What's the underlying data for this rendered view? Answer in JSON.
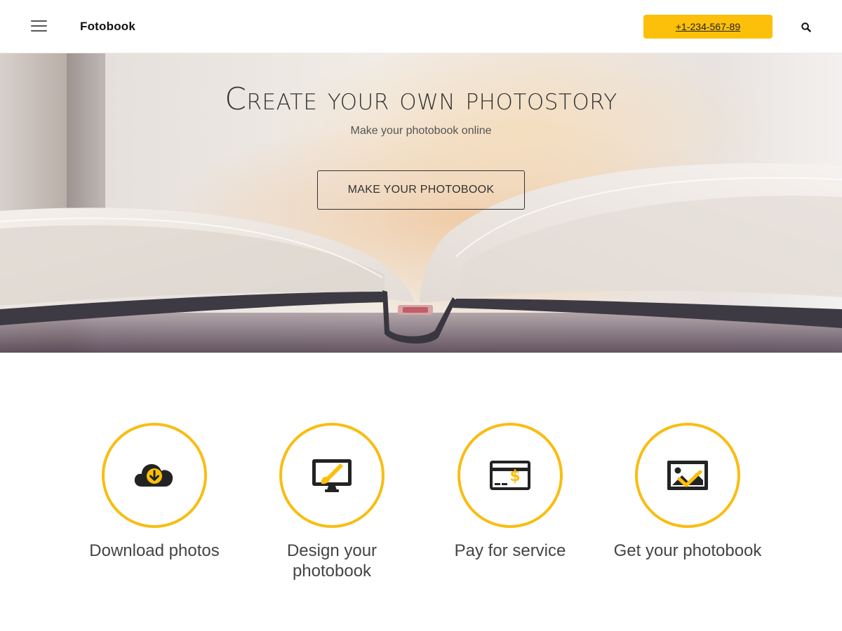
{
  "header": {
    "brand": "Fotobook",
    "phone": "+1-234-567-89",
    "menu_icon": "hamburger-menu-icon",
    "search_icon": "search-icon",
    "accent_color": "#fcbf0a"
  },
  "hero": {
    "title": "Create your own photostory",
    "subtitle": "Make your photobook online",
    "cta_label": "MAKE YOUR PHOTOBOOK"
  },
  "steps": [
    {
      "icon": "cloud-download-icon",
      "label": "Download photos"
    },
    {
      "icon": "monitor-brush-icon",
      "label": "Design your photobook"
    },
    {
      "icon": "card-dollar-icon",
      "label": "Pay for service"
    },
    {
      "icon": "image-check-icon",
      "label": "Get your photobook"
    }
  ],
  "colors": {
    "accent": "#fcbf0a",
    "circle_border": "#f9bd12",
    "icon_dark": "#232323"
  }
}
